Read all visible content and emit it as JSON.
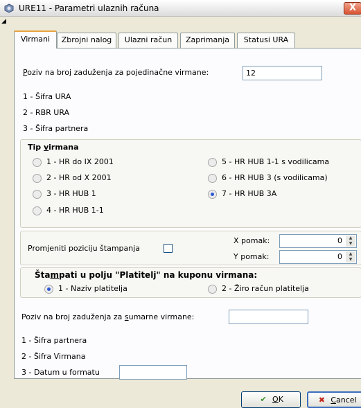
{
  "window": {
    "title": "URE11 - Parametri ulaznih računa",
    "close_label": "X",
    "icon_name": "app-settings-icon"
  },
  "tabs": [
    {
      "label": "Virmani",
      "active": true
    },
    {
      "label": "Zbrojni nalog",
      "active": false
    },
    {
      "label": "Ulazni račun",
      "active": false
    },
    {
      "label": "Zaprimanja",
      "active": false
    },
    {
      "label": "Statusi URA",
      "active": false
    }
  ],
  "poziv": {
    "label_accel": "P",
    "label_rest": "oziv na broj zaduženja za pojedinačne virmane:",
    "value": "12",
    "options": [
      "1 - Šifra URA",
      "2 - RBR URA",
      "3 - Šifra partnera"
    ]
  },
  "tip_virmana": {
    "title_pre": "Tip ",
    "title_accel": "v",
    "title_post": "irmana",
    "options": [
      {
        "label": "1 - HR do IX 2001",
        "checked": false
      },
      {
        "label": "2 - HR od X 2001",
        "checked": false
      },
      {
        "label": "3 - HR HUB 1",
        "checked": false
      },
      {
        "label": "4 - HR HUB 1-1",
        "checked": false
      },
      {
        "label": "5 - HR HUB 1-1 s vodilicama",
        "checked": false
      },
      {
        "label": "6 - HR HUB 3 (s vodilicama)",
        "checked": false
      },
      {
        "label": "7 - HR HUB 3A",
        "checked": true
      }
    ]
  },
  "pozicija": {
    "label": "Promjeniti poziciju štampanja",
    "checked": false,
    "x_label": "X pomak:",
    "x_value": "0",
    "y_label": "Y pomak:",
    "y_value": "0"
  },
  "platitelj": {
    "title_pre": "Šta",
    "title_accel": "m",
    "title_post": "pati u polju \"Platitelj\" na kuponu virmana:",
    "options": [
      {
        "label": "1 - Naziv platitelja",
        "checked": true
      },
      {
        "label": "2 - Žiro račun platitelja",
        "checked": false
      }
    ]
  },
  "sumarni": {
    "label_pre": "Poziv na broj zaduženja za ",
    "label_accel": "s",
    "label_post": "umarne virmane:",
    "value": "",
    "options": [
      "1 - Šifra partnera",
      "2 - Šifra Virmana"
    ],
    "datum_label": "3 - Datum u formatu",
    "datum_value": ""
  },
  "buttons": {
    "ok_accel": "O",
    "ok_rest": "K",
    "ok_icon": "check-icon",
    "cancel_accel": "C",
    "cancel_rest": "ancel",
    "cancel_icon": "cancel-x-icon"
  },
  "colors": {
    "accent": "#e8a33f",
    "ok_check": "#3a8f2a",
    "cancel_x": "#c0281b",
    "radio_selected": "#2f59d1"
  }
}
